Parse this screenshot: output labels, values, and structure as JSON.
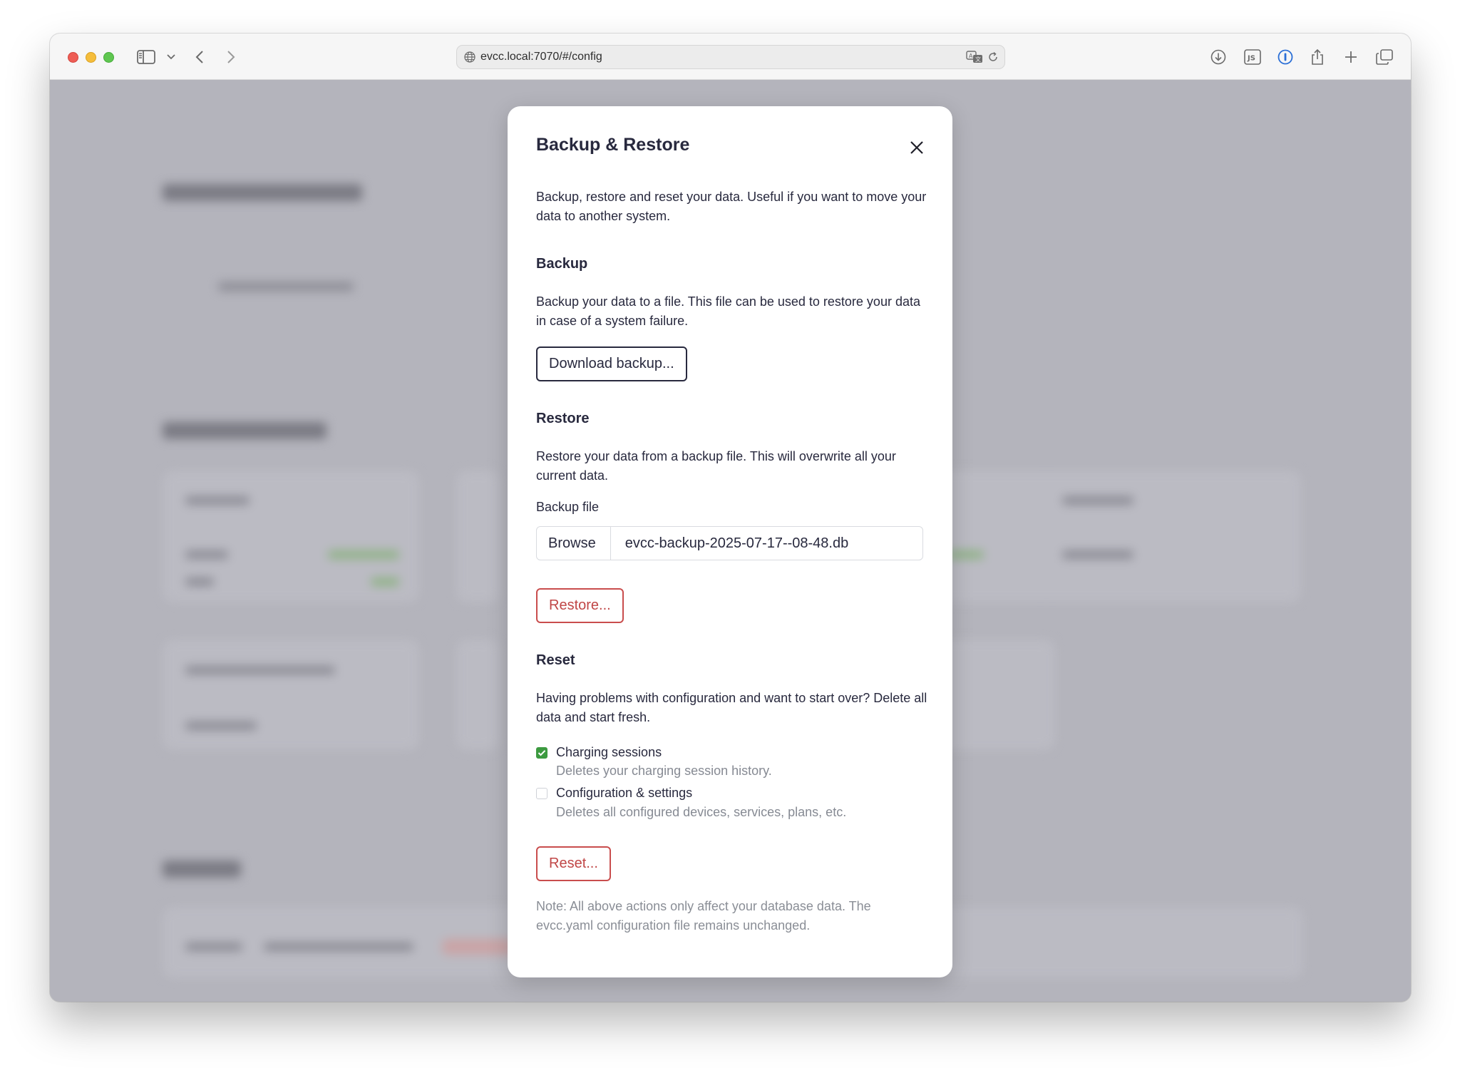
{
  "browser": {
    "url": "evcc.local:7070/#/config",
    "icons": {
      "sidebar": "sidebar-icon",
      "back": "chevron-left-icon",
      "forward": "chevron-right-icon",
      "download": "download-icon",
      "js": "JS",
      "share": "share-icon",
      "new_tab": "plus-icon",
      "tabs": "tabs-icon"
    }
  },
  "modal": {
    "title": "Backup & Restore",
    "intro": "Backup, restore and reset your data. Useful if you want to move your data to another system.",
    "backup": {
      "heading": "Backup",
      "description": "Backup your data to a file. This file can be used to restore your data in case of a system failure.",
      "button_label": "Download backup..."
    },
    "restore": {
      "heading": "Restore",
      "description": "Restore your data from a backup file. This will overwrite all your current data.",
      "file_label": "Backup file",
      "browse_label": "Browse",
      "file_name": "evcc-backup-2025-07-17--08-48.db",
      "button_label": "Restore..."
    },
    "reset": {
      "heading": "Reset",
      "description": "Having problems with configuration and want to start over? Delete all data and start fresh.",
      "options": [
        {
          "label": "Charging sessions",
          "description": "Deletes your charging session history.",
          "checked": true
        },
        {
          "label": "Configuration & settings",
          "description": "Deletes all configured devices, services, plans, etc.",
          "checked": false
        }
      ],
      "button_label": "Reset..."
    },
    "note": "Note: All above actions only affect your database data. The evcc.yaml configuration file remains unchanged."
  },
  "colors": {
    "text": "#28293e",
    "danger": "#c04646",
    "checkbox_checked": "#3c9a40",
    "overlay": "#b4b4bc"
  }
}
